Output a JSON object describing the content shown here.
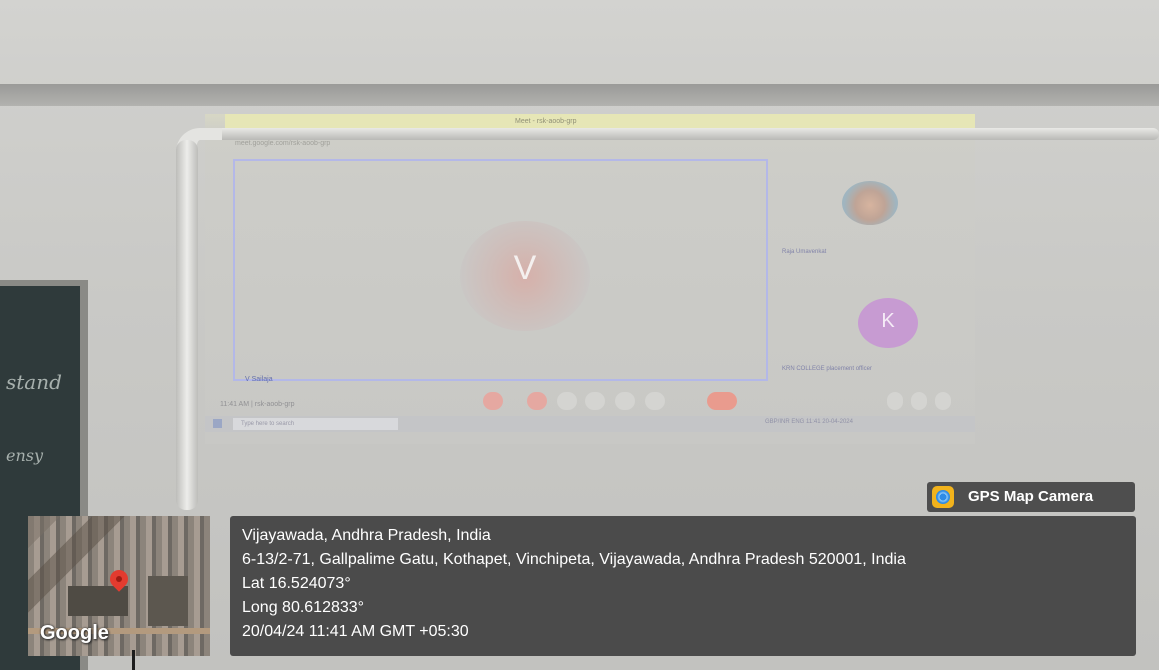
{
  "projection": {
    "tab_title": "Meet - rsk-aoob-grp",
    "url": "meet.google.com/rsk-aoob-grp",
    "main_participant": {
      "initial": "V",
      "name": "V Sailaja"
    },
    "participants": [
      {
        "name": "Raja Umavenkat",
        "type": "photo"
      },
      {
        "initial": "K",
        "name": "KRN COLLEGE placement officer",
        "type": "avatar"
      }
    ],
    "meeting_time": "11:41 AM",
    "meeting_code": "rsk-aoob-grp",
    "taskbar": {
      "search_placeholder": "Type here to search",
      "tray_item": "GBP/INR",
      "lang": "ENG",
      "clock_time": "11:41",
      "clock_date": "20-04-2024"
    }
  },
  "board": {
    "text1": "stand",
    "text2": "ensy"
  },
  "gps": {
    "app_name": "GPS Map Camera",
    "map_brand": "Google",
    "place": "Vijayawada, Andhra Pradesh, India",
    "address": "6-13/2-71, Gallpalime Gatu, Kothapet, Vinchipeta, Vijayawada, Andhra Pradesh 520001, India",
    "lat": "Lat 16.524073°",
    "long": "Long 80.612833°",
    "datetime": "20/04/24 11:41 AM GMT +05:30"
  },
  "colors": {
    "overlay": "#4b4b4b",
    "avatar_v": "#d7b0a9",
    "avatar_k": "#c79ad3",
    "pin": "#e33b2f"
  },
  "icons": [
    "gps-camera-icon",
    "map-pin-icon",
    "mic-icon",
    "end-call-icon",
    "windows-icon"
  ]
}
